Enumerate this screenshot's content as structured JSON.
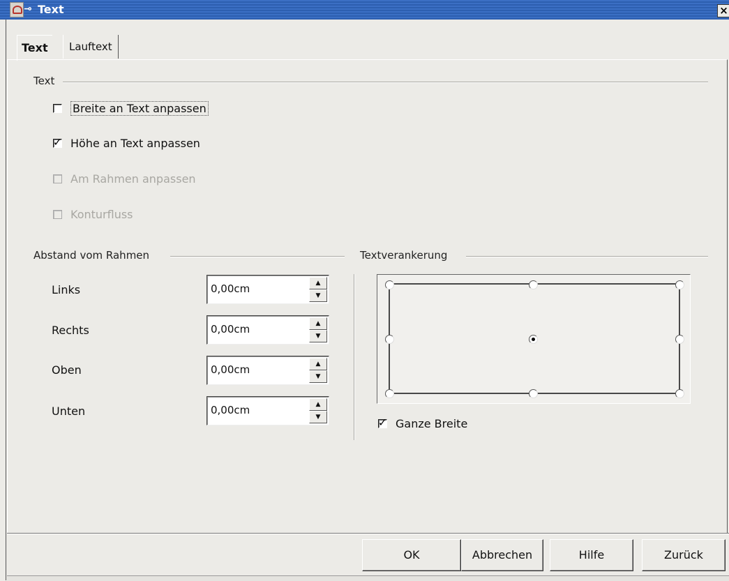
{
  "window": {
    "title": "Text",
    "close_glyph": "×"
  },
  "tabs": [
    {
      "label": "Text",
      "active": true
    },
    {
      "label": "Lauftext",
      "active": false
    }
  ],
  "text_group": {
    "label": "Text",
    "options": [
      {
        "label": "Breite an Text anpassen",
        "checked": false,
        "enabled": true
      },
      {
        "label": "Höhe an Text anpassen",
        "checked": true,
        "enabled": true
      },
      {
        "label": "Am Rahmen anpassen",
        "checked": false,
        "enabled": false
      },
      {
        "label": "Konturfluss",
        "checked": false,
        "enabled": false
      }
    ]
  },
  "spacing_group": {
    "label": "Abstand vom Rahmen",
    "fields": [
      {
        "label": "Links",
        "value": "0,00cm"
      },
      {
        "label": "Rechts",
        "value": "0,00cm"
      },
      {
        "label": "Oben",
        "value": "0,00cm"
      },
      {
        "label": "Unten",
        "value": "0,00cm"
      }
    ]
  },
  "anchor_group": {
    "label": "Textverankerung",
    "selected": "center",
    "full_width": {
      "label": "Ganze Breite",
      "checked": true
    }
  },
  "buttons": {
    "ok": "OK",
    "cancel": "Abbrechen",
    "help": "Hilfe",
    "reset": "Zurück"
  },
  "icons": {
    "title_icon": "app-icon",
    "pin": "pin-icon",
    "close": "close-icon"
  }
}
